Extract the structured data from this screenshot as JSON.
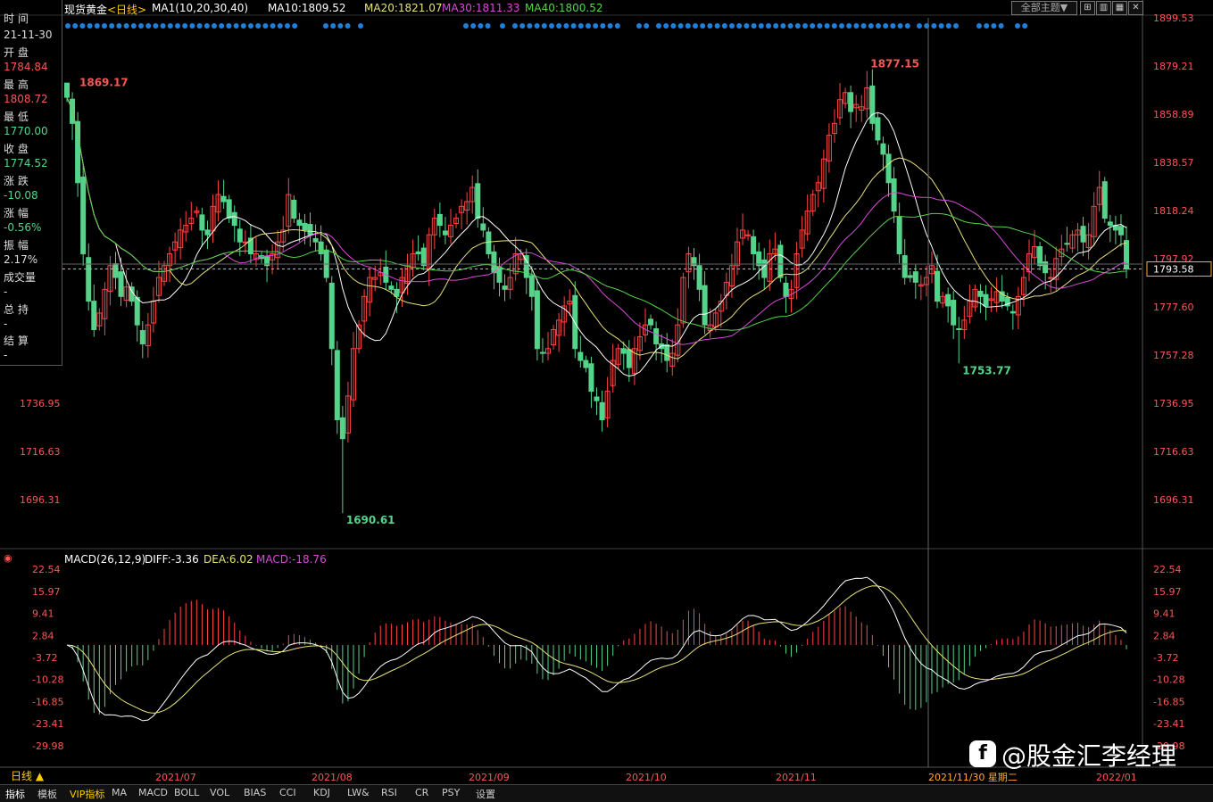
{
  "header": {
    "title": "现货黄金",
    "period": "<日线>",
    "ma_label": "MA1(10,20,30,40)",
    "ma10": "MA10:1809.52",
    "ma20": "MA20:1821.07",
    "ma30": "MA30:1811.33",
    "ma40": "MA40:1800.52",
    "theme_btn": "全部主题▼"
  },
  "colors": {
    "up": "#ff4444",
    "down": "#54d48a",
    "ma10": "#ffffff",
    "ma20": "#e8e27a",
    "ma30": "#d84bd8",
    "ma40": "#54d44b",
    "axis": "#ff5555",
    "dot": "#1f7fd8"
  },
  "info_panel": {
    "time_label": "时 间",
    "time_value": "21-11-30",
    "open_label": "开 盘",
    "open_value": "1784.84",
    "high_label": "最 高",
    "high_value": "1808.72",
    "low_label": "最 低",
    "low_value": "1770.00",
    "close_label": "收 盘",
    "close_value": "1774.52",
    "change_label": "涨 跌",
    "change_value": "-10.08",
    "pct_label": "涨 幅",
    "pct_value": "-0.56%",
    "amp_label": "振 幅",
    "amp_value": "2.17%",
    "vol_label": "成交量",
    "vol_value": "-",
    "hold_label": "总 持",
    "hold_value": "-",
    "settle_label": "结 算",
    "settle_value": "-"
  },
  "chart_data": [
    {
      "type": "candlestick",
      "title": "现货黄金",
      "y_ticks": [
        1899.53,
        1879.21,
        1858.89,
        1838.57,
        1818.24,
        1797.92,
        1777.6,
        1757.28,
        1736.95,
        1716.63,
        1696.31
      ],
      "ylim": [
        1690.61,
        1899.53
      ],
      "current_price": "1793.58",
      "annotations": [
        {
          "label": "1869.17",
          "value": 1869.17
        },
        {
          "label": "1877.15",
          "value": 1877.15
        },
        {
          "label": "1690.61",
          "value": 1690.61
        },
        {
          "label": "1753.77",
          "value": 1753.77
        }
      ],
      "x_labels": [
        "2021/07",
        "2021/08",
        "2021/09",
        "2021/10",
        "2021/11",
        "2021/11/30 星期二",
        "2022/01"
      ],
      "close_series": [
        1866,
        1855,
        1830,
        1800,
        1780,
        1768,
        1775,
        1785,
        1795,
        1790,
        1782,
        1786,
        1780,
        1770,
        1762,
        1770,
        1780,
        1790,
        1795,
        1800,
        1805,
        1810,
        1812,
        1815,
        1818,
        1810,
        1808,
        1820,
        1825,
        1822,
        1815,
        1812,
        1805,
        1805,
        1800,
        1800,
        1798,
        1795,
        1800,
        1805,
        1810,
        1825,
        1815,
        1812,
        1810,
        1808,
        1805,
        1800,
        1790,
        1760,
        1730,
        1722,
        1740,
        1760,
        1770,
        1782,
        1790,
        1790,
        1792,
        1788,
        1785,
        1782,
        1790,
        1795,
        1800,
        1800,
        1795,
        1808,
        1815,
        1812,
        1808,
        1812,
        1815,
        1820,
        1822,
        1828,
        1815,
        1810,
        1800,
        1792,
        1788,
        1785,
        1790,
        1800,
        1800,
        1790,
        1782,
        1760,
        1758,
        1760,
        1768,
        1772,
        1778,
        1780,
        1760,
        1755,
        1752,
        1742,
        1738,
        1730,
        1742,
        1755,
        1760,
        1758,
        1752,
        1760,
        1765,
        1770,
        1770,
        1762,
        1760,
        1755,
        1758,
        1770,
        1790,
        1800,
        1795,
        1785,
        1770,
        1770,
        1775,
        1780,
        1788,
        1795,
        1805,
        1810,
        1808,
        1800,
        1795,
        1790,
        1800,
        1802,
        1790,
        1782,
        1785,
        1800,
        1810,
        1818,
        1825,
        1830,
        1840,
        1850,
        1855,
        1865,
        1868,
        1860,
        1863,
        1862,
        1870,
        1855,
        1848,
        1842,
        1830,
        1818,
        1800,
        1790,
        1790,
        1788,
        1787,
        1790,
        1795,
        1780,
        1782,
        1778,
        1770,
        1768,
        1772,
        1780,
        1785,
        1782,
        1778,
        1781,
        1784,
        1780,
        1778,
        1775,
        1782,
        1790,
        1800,
        1803,
        1795,
        1792,
        1790,
        1798,
        1802,
        1804,
        1808,
        1810,
        1805,
        1808,
        1820,
        1828,
        1815,
        1812,
        1810,
        1808,
        1793.58
      ],
      "ma_series": [
        "MA10",
        "MA20",
        "MA30",
        "MA40"
      ]
    },
    {
      "type": "bar",
      "title": "MACD(26,12,9)",
      "diff": "DIFF:-3.36",
      "dea": "DEA:6.02",
      "macd": "MACD:-18.76",
      "y_ticks": [
        22.54,
        15.97,
        9.41,
        2.84,
        -3.72,
        -10.28,
        -16.85,
        -23.41,
        -29.98
      ],
      "ylim": [
        -29.98,
        22.54
      ]
    }
  ],
  "footer": {
    "period_btn": "日线 ▲",
    "tabs": [
      "指标",
      "模板",
      "VIP指标",
      "MA",
      "MACD",
      "BOLL",
      "VOL",
      "BIAS",
      "CCI",
      "KDJ",
      "LW&",
      "RSI",
      "CR",
      "PSY",
      "设置"
    ],
    "watermark": "@股金汇李经理"
  }
}
